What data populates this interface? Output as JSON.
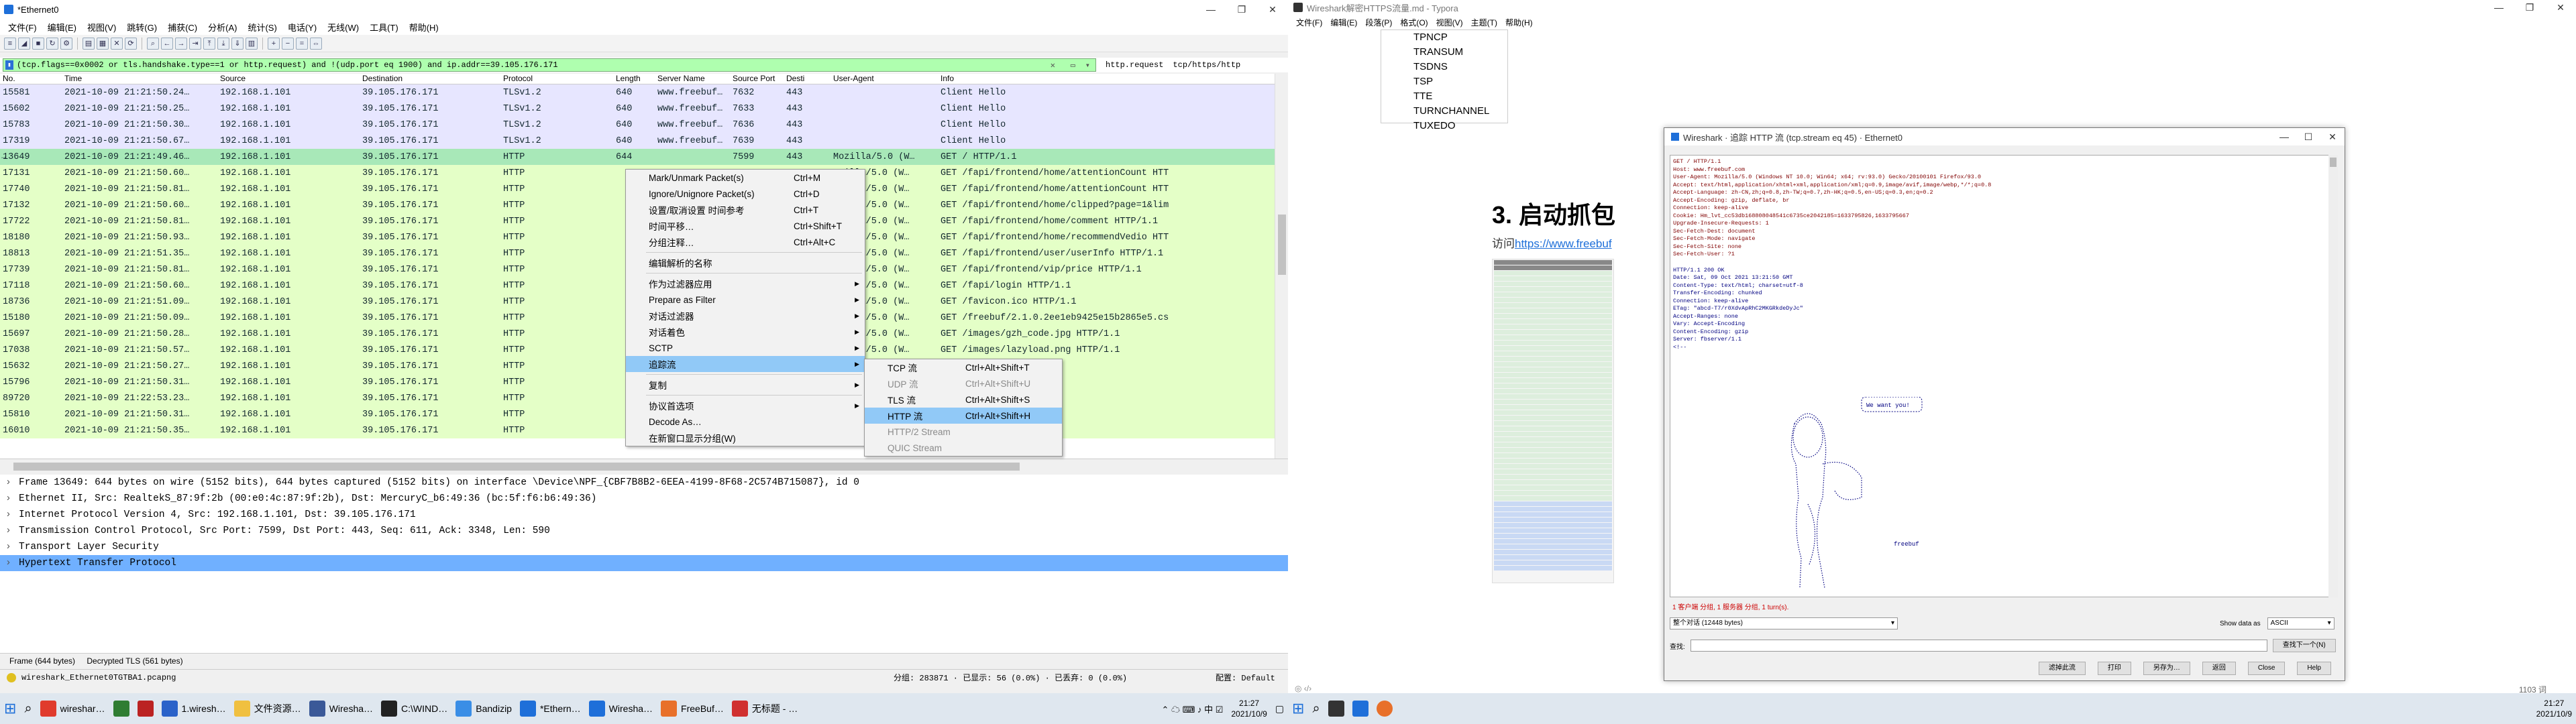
{
  "left": {
    "title": "*Ethernet0",
    "menus": [
      "文件(F)",
      "编辑(E)",
      "视图(V)",
      "跳转(G)",
      "捕获(C)",
      "分析(A)",
      "统计(S)",
      "电话(Y)",
      "无线(W)",
      "工具(T)",
      "帮助(H)"
    ],
    "filter": {
      "text": "(tcp.flags==0x0002 or tls.handshake.type==1 or http.request) and !(udp.port eq 1900) and ip.addr==39.105.176.171",
      "buttons": [
        "http.request",
        "tcp/https/http"
      ]
    },
    "columns": [
      "No.",
      "Time",
      "Source",
      "Destination",
      "Protocol",
      "Length",
      "Server Name",
      "Source Port",
      "Desti",
      "User-Agent",
      "Info"
    ],
    "packets": [
      {
        "no": "15581",
        "time": "2021-10-09 21:21:50.24…",
        "src": "192.168.1.101",
        "dst": "39.105.176.171",
        "proto": "TLSv1.2",
        "len": "640",
        "server": "www.freebuf…",
        "sport": "7632",
        "dport": "443",
        "ua": "",
        "info": "Client Hello",
        "color": "#e7e6ff"
      },
      {
        "no": "15602",
        "time": "2021-10-09 21:21:50.25…",
        "src": "192.168.1.101",
        "dst": "39.105.176.171",
        "proto": "TLSv1.2",
        "len": "640",
        "server": "www.freebuf…",
        "sport": "7633",
        "dport": "443",
        "ua": "",
        "info": "Client Hello",
        "color": "#e7e6ff"
      },
      {
        "no": "15783",
        "time": "2021-10-09 21:21:50.30…",
        "src": "192.168.1.101",
        "dst": "39.105.176.171",
        "proto": "TLSv1.2",
        "len": "640",
        "server": "www.freebuf…",
        "sport": "7636",
        "dport": "443",
        "ua": "",
        "info": "Client Hello",
        "color": "#e7e6ff"
      },
      {
        "no": "17319",
        "time": "2021-10-09 21:21:50.67…",
        "src": "192.168.1.101",
        "dst": "39.105.176.171",
        "proto": "TLSv1.2",
        "len": "640",
        "server": "www.freebuf…",
        "sport": "7639",
        "dport": "443",
        "ua": "",
        "info": "Client Hello",
        "color": "#e7e6ff"
      },
      {
        "no": "13649",
        "time": "2021-10-09 21:21:49.46…",
        "src": "192.168.1.101",
        "dst": "39.105.176.171",
        "proto": "HTTP",
        "len": "644",
        "server": "",
        "sport": "7599",
        "dport": "443",
        "ua": "Mozilla/5.0 (W…",
        "info": "GET / HTTP/1.1",
        "color": "#a8e8b8",
        "marker": "→"
      },
      {
        "no": "17131",
        "time": "2021-10-09 21:21:50.60…",
        "src": "192.168.1.101",
        "dst": "39.105.176.171",
        "proto": "HTTP",
        "len": "",
        "server": "",
        "sport": "",
        "dport": "",
        "ua": "ozilla/5.0 (W…",
        "info": "GET /fapi/frontend/home/attentionCount HTT",
        "color": "#e4ffc7"
      },
      {
        "no": "17740",
        "time": "2021-10-09 21:21:50.81…",
        "src": "192.168.1.101",
        "dst": "39.105.176.171",
        "proto": "HTTP",
        "len": "",
        "server": "",
        "sport": "",
        "dport": "",
        "ua": "ozilla/5.0 (W…",
        "info": "GET /fapi/frontend/home/attentionCount HTT",
        "color": "#e4ffc7"
      },
      {
        "no": "17132",
        "time": "2021-10-09 21:21:50.60…",
        "src": "192.168.1.101",
        "dst": "39.105.176.171",
        "proto": "HTTP",
        "len": "",
        "server": "",
        "sport": "",
        "dport": "",
        "ua": "ozilla/5.0 (W…",
        "info": "GET /fapi/frontend/home/clipped?page=1&lim",
        "color": "#e4ffc7"
      },
      {
        "no": "17722",
        "time": "2021-10-09 21:21:50.81…",
        "src": "192.168.1.101",
        "dst": "39.105.176.171",
        "proto": "HTTP",
        "len": "",
        "server": "",
        "sport": "",
        "dport": "",
        "ua": "ozilla/5.0 (W…",
        "info": "GET /fapi/frontend/home/comment HTTP/1.1",
        "color": "#e4ffc7"
      },
      {
        "no": "18180",
        "time": "2021-10-09 21:21:50.93…",
        "src": "192.168.1.101",
        "dst": "39.105.176.171",
        "proto": "HTTP",
        "len": "",
        "server": "",
        "sport": "",
        "dport": "",
        "ua": "ozilla/5.0 (W…",
        "info": "GET /fapi/frontend/home/recommendVedio HTT",
        "color": "#e4ffc7"
      },
      {
        "no": "18813",
        "time": "2021-10-09 21:21:51.35…",
        "src": "192.168.1.101",
        "dst": "39.105.176.171",
        "proto": "HTTP",
        "len": "",
        "server": "",
        "sport": "",
        "dport": "",
        "ua": "ozilla/5.0 (W…",
        "info": "GET /fapi/frontend/user/userInfo HTTP/1.1",
        "color": "#e4ffc7"
      },
      {
        "no": "17739",
        "time": "2021-10-09 21:21:50.81…",
        "src": "192.168.1.101",
        "dst": "39.105.176.171",
        "proto": "HTTP",
        "len": "",
        "server": "",
        "sport": "",
        "dport": "",
        "ua": "ozilla/5.0 (W…",
        "info": "GET /fapi/frontend/vip/price HTTP/1.1",
        "color": "#e4ffc7"
      },
      {
        "no": "17118",
        "time": "2021-10-09 21:21:50.60…",
        "src": "192.168.1.101",
        "dst": "39.105.176.171",
        "proto": "HTTP",
        "len": "",
        "server": "",
        "sport": "",
        "dport": "",
        "ua": "ozilla/5.0 (W…",
        "info": "GET /fapi/login HTTP/1.1",
        "color": "#e4ffc7"
      },
      {
        "no": "18736",
        "time": "2021-10-09 21:21:51.09…",
        "src": "192.168.1.101",
        "dst": "39.105.176.171",
        "proto": "HTTP",
        "len": "",
        "server": "",
        "sport": "",
        "dport": "",
        "ua": "ozilla/5.0 (W…",
        "info": "GET /favicon.ico HTTP/1.1",
        "color": "#e4ffc7"
      },
      {
        "no": "15180",
        "time": "2021-10-09 21:21:50.09…",
        "src": "192.168.1.101",
        "dst": "39.105.176.171",
        "proto": "HTTP",
        "len": "",
        "server": "",
        "sport": "",
        "dport": "",
        "ua": "ozilla/5.0 (W…",
        "info": "GET /freebuf/2.1.0.2ee1eb9425e15b2865e5.cs",
        "color": "#e4ffc7"
      },
      {
        "no": "15697",
        "time": "2021-10-09 21:21:50.28…",
        "src": "192.168.1.101",
        "dst": "39.105.176.171",
        "proto": "HTTP",
        "len": "",
        "server": "",
        "sport": "",
        "dport": "",
        "ua": "ozilla/5.0 (W…",
        "info": "GET /images/gzh_code.jpg HTTP/1.1",
        "color": "#e4ffc7"
      },
      {
        "no": "17038",
        "time": "2021-10-09 21:21:50.57…",
        "src": "192.168.1.101",
        "dst": "39.105.176.171",
        "proto": "HTTP",
        "len": "",
        "server": "",
        "sport": "",
        "dport": "",
        "ua": "ozilla/5.0 (W…",
        "info": "GET /images/lazyload.png HTTP/1.1",
        "color": "#e4ffc7"
      },
      {
        "no": "15632",
        "time": "2021-10-09 21:21:50.27…",
        "src": "192.168.1.101",
        "dst": "39.105.176.171",
        "proto": "HTTP",
        "len": "",
        "server": "",
        "sport": "",
        "dport": "",
        "ua": "",
        "info": "goMax.png HTTP/1.1",
        "color": "#e4ffc7"
      },
      {
        "no": "15796",
        "time": "2021-10-09 21:21:50.31…",
        "src": "192.168.1.101",
        "dst": "39.105.176.171",
        "proto": "HTTP",
        "len": "",
        "server": "",
        "sport": "",
        "dport": "",
        "ua": "",
        "info": "go_b.png HTTP/1.1",
        "color": "#e4ffc7"
      },
      {
        "no": "89720",
        "time": "2021-10-09 21:22:53.23…",
        "src": "192.168.1.101",
        "dst": "39.105.176.171",
        "proto": "HTTP",
        "len": "",
        "server": "",
        "sport": "",
        "dport": "",
        "ua": "",
        "info": "aq_code.png HTTP/1.1",
        "color": "#e4ffc7"
      },
      {
        "no": "15810",
        "time": "2021-10-09 21:21:50.31…",
        "src": "192.168.1.101",
        "dst": "39.105.176.171",
        "proto": "HTTP",
        "len": "",
        "server": "",
        "sport": "",
        "dport": "",
        "ua": "",
        "info": "x-code.jpg HTTP/1.1",
        "color": "#e4ffc7"
      },
      {
        "no": "16010",
        "time": "2021-10-09 21:21:50.35…",
        "src": "192.168.1.101",
        "dst": "39.105.176.171",
        "proto": "HTTP",
        "len": "",
        "server": "",
        "sport": "",
        "dport": "",
        "ua": "",
        "info": "x-code.png HTTP/1.1",
        "color": "#e4ffc7"
      }
    ],
    "details": [
      "Frame 13649: 644 bytes on wire (5152 bits), 644 bytes captured (5152 bits) on interface \\Device\\NPF_{CBF7B8B2-6EEA-4199-8F68-2C574B715087}, id 0",
      "Ethernet II, Src: RealtekS_87:9f:2b (00:e0:4c:87:9f:2b), Dst: MercuryC_b6:49:36 (bc:5f:f6:b6:49:36)",
      "Internet Protocol Version 4, Src: 192.168.1.101, Dst: 39.105.176.171",
      "Transmission Control Protocol, Src Port: 7599, Dst Port: 443, Seq: 611, Ack: 3348, Len: 590",
      "Transport Layer Security",
      "Hypertext Transfer Protocol"
    ],
    "bytes_tabs": [
      "Frame (644 bytes)",
      "Decrypted TLS (561 bytes)"
    ],
    "status": {
      "file": "wireshark_Ethernet0TGTBA1.pcapng",
      "packets": "分组: 283871 · 已显示: 56 (0.0%) · 已丢弃: 0 (0.0%)",
      "profile": "配置: Default"
    },
    "taskbar": [
      {
        "label": "wireshar…",
        "color": "#e03b2d"
      },
      {
        "label": "",
        "color": "#2f7d32"
      },
      {
        "label": "",
        "color": "#bb2222"
      },
      {
        "label": "1.wiresh…",
        "color": "#2a62c9"
      },
      {
        "label": "文件资源…",
        "color": "#f0c040"
      },
      {
        "label": "Wiresha…",
        "color": "#3b5998"
      },
      {
        "label": "C:\\WIND…",
        "color": "#222"
      },
      {
        "label": "Bandizip",
        "color": "#3a8ee6"
      },
      {
        "label": "*Ethern…",
        "color": "#1e6fd9"
      },
      {
        "label": "Wiresha…",
        "color": "#1e6fd9"
      },
      {
        "label": "FreeBuf…",
        "color": "#e8702a"
      },
      {
        "label": "无标题 - …",
        "color": "#d03030"
      }
    ],
    "clock_time": "21:27",
    "clock_date": "2021/10/9",
    "context_menu": [
      {
        "label": "Mark/Unmark Packet(s)",
        "shortcut": "Ctrl+M"
      },
      {
        "label": "Ignore/Unignore Packet(s)",
        "shortcut": "Ctrl+D"
      },
      {
        "label": "设置/取消设置 时间参考",
        "shortcut": "Ctrl+T"
      },
      {
        "label": "时间平移…",
        "shortcut": "Ctrl+Shift+T"
      },
      {
        "label": "分组注释…",
        "shortcut": "Ctrl+Alt+C"
      },
      {
        "sep": true
      },
      {
        "label": "编辑解析的名称",
        "shortcut": ""
      },
      {
        "sep": true
      },
      {
        "label": "作为过滤器应用",
        "shortcut": "",
        "sub": true
      },
      {
        "label": "Prepare as Filter",
        "shortcut": "",
        "sub": true
      },
      {
        "label": "对话过滤器",
        "shortcut": "",
        "sub": true
      },
      {
        "label": "对话着色",
        "shortcut": "",
        "sub": true
      },
      {
        "label": "SCTP",
        "shortcut": "",
        "sub": true
      },
      {
        "label": "追踪流",
        "shortcut": "",
        "sub": true,
        "hl": true
      },
      {
        "sep": true
      },
      {
        "label": "复制",
        "shortcut": "",
        "sub": true
      },
      {
        "sep": true
      },
      {
        "label": "协议首选项",
        "shortcut": "",
        "sub": true
      },
      {
        "label": "Decode As…",
        "shortcut": ""
      },
      {
        "label": "在新窗口显示分组(W)",
        "shortcut": ""
      }
    ],
    "submenu": [
      {
        "label": "TCP 流",
        "shortcut": "Ctrl+Alt+Shift+T"
      },
      {
        "label": "UDP 流",
        "shortcut": "Ctrl+Alt+Shift+U",
        "dis": true
      },
      {
        "label": "TLS 流",
        "shortcut": "Ctrl+Alt+Shift+S"
      },
      {
        "label": "HTTP 流",
        "shortcut": "Ctrl+Alt+Shift+H",
        "hl": true
      },
      {
        "label": "HTTP/2 Stream",
        "shortcut": "",
        "dis": true
      },
      {
        "label": "QUIC Stream",
        "shortcut": "",
        "dis": true
      }
    ]
  },
  "right": {
    "title": "Wireshark解密HTTPS流量.md - Typora",
    "menus": [
      "文件(F)",
      "编辑(E)",
      "段落(P)",
      "格式(O)",
      "视图(V)",
      "主题(T)",
      "帮助(H)"
    ],
    "list": [
      "TPNCP",
      "TRANSUM",
      "TSDNS",
      "TSP",
      "TTE",
      "TURNCHANNEL",
      "TUXEDO"
    ],
    "heading": "3. 启动抓包",
    "para_prefix": "访问",
    "link": "https://www.freebuf",
    "word_count": "1103 词",
    "follow": {
      "title": "Wireshark · 追踪 HTTP 流 (tcp.stream eq 45) · Ethernet0",
      "request": [
        "GET / HTTP/1.1",
        "Host: www.freebuf.com",
        "User-Agent: Mozilla/5.0 (Windows NT 10.0; Win64; x64; rv:93.0) Gecko/20100101 Firefox/93.0",
        "Accept: text/html,application/xhtml+xml,application/xml;q=0.9,image/avif,image/webp,*/*;q=0.8",
        "Accept-Language: zh-CN,zh;q=0.8,zh-TW;q=0.7,zh-HK;q=0.5,en-US;q=0.3,en;q=0.2",
        "Accept-Encoding: gzip, deflate, br",
        "Connection: keep-alive",
        "Cookie: Hm_lvt_cc53db168808048541c6735ce2042185=1633795826,1633795667",
        "Upgrade-Insecure-Requests: 1",
        "Sec-Fetch-Dest: document",
        "Sec-Fetch-Mode: navigate",
        "Sec-Fetch-Site: none",
        "Sec-Fetch-User: ?1"
      ],
      "response": [
        "HTTP/1.1 200 OK",
        "Date: Sat, 09 Oct 2021 13:21:50 GMT",
        "Content-Type: text/html; charset=utf-8",
        "Transfer-Encoding: chunked",
        "Connection: keep-alive",
        "ETag: \"abcd-T7/r0XdvApRhC2MKGRkdeDyJc\"",
        "Accept-Ranges: none",
        "Vary: Accept-Encoding",
        "Content-Encoding: gzip",
        "Server: fbserver/1.1",
        "",
        "<!--"
      ],
      "art_speech": "We want you!",
      "art_label": "freebuf",
      "info": "1 客户端 分组, 1 服务器 分组, 1 turn(s).",
      "conv": "整个对话 (12448 bytes)",
      "show_as_label": "Show data as",
      "show_as": "ASCII",
      "find_label": "查找:",
      "find_next": "查找下一个(N)",
      "buttons": [
        "滤掉此流",
        "打印",
        "另存为…",
        "返回",
        "Close",
        "Help"
      ]
    }
  }
}
